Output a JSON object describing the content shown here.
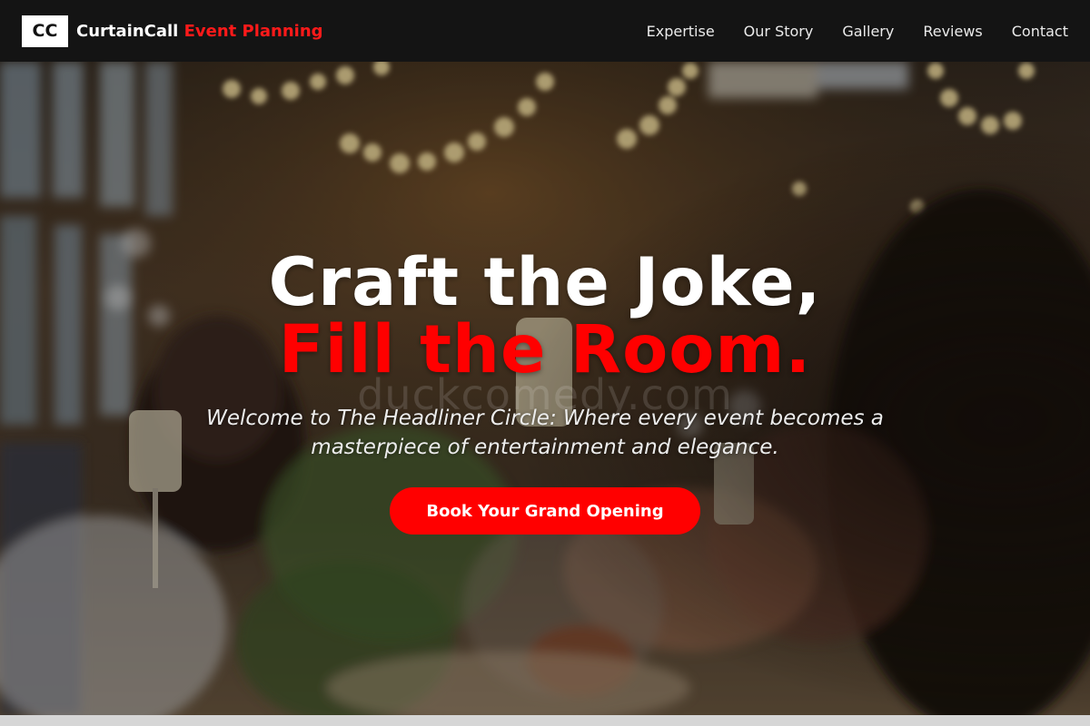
{
  "brand": {
    "logo_text": "CC",
    "name": "CurtainCall",
    "accent": "Event Planning"
  },
  "nav": {
    "items": [
      "Expertise",
      "Our Story",
      "Gallery",
      "Reviews",
      "Contact"
    ]
  },
  "hero": {
    "headline_line1": "Craft the Joke,",
    "headline_line2": "Fill the Room.",
    "watermark": "duckcomedy.com",
    "tagline": "Welcome to The Headliner Circle: Where every event becomes a masterpiece of entertainment and elegance.",
    "cta_label": "Book Your Grand Opening",
    "background_image": "banquet-toast-photo"
  },
  "colors": {
    "nav_bg": "#141414",
    "accent_red": "#ff0000",
    "text_white": "#ffffff"
  }
}
